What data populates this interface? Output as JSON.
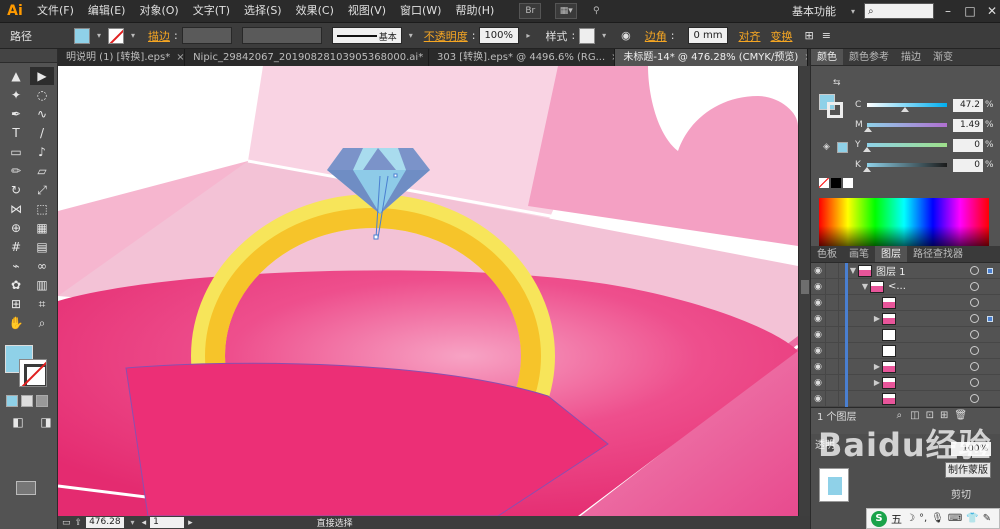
{
  "app": {
    "logo": "Ai",
    "workspace": "基本功能",
    "search_placeholder": ""
  },
  "menu": [
    "文件(F)",
    "编辑(E)",
    "对象(O)",
    "文字(T)",
    "选择(S)",
    "效果(C)",
    "视图(V)",
    "窗口(W)",
    "帮助(H)"
  ],
  "menubar_icons": [
    "bridge-icon",
    "arrange-documents-icon",
    "gpu-icon"
  ],
  "control": {
    "type_label": "路径",
    "stroke_label": "描边",
    "stroke_style": "基本",
    "opacity_label": "不透明度",
    "opacity_value": "100%",
    "style_label": "样式",
    "corner_label": "边角",
    "corner_value": "0 mm",
    "align_label": "对齐",
    "transform_label": "变换"
  },
  "tabs": [
    {
      "label": "明说明 (1) [转换].eps*",
      "active": false
    },
    {
      "label": "Nipic_29842067_20190828103905368000.ai*",
      "active": false
    },
    {
      "label": "303 [转换].eps* @ 4496.6% (RG...",
      "active": false
    },
    {
      "label": "未标题-14* @ 476.28% (CMYK/预览)",
      "active": true
    }
  ],
  "tools": [
    [
      "selection-tool-icon",
      "▲"
    ],
    [
      "direct-selection-tool-icon",
      "▶"
    ],
    [
      "magic-wand-tool-icon",
      "✦"
    ],
    [
      "lasso-tool-icon",
      "◌"
    ],
    [
      "pen-tool-icon",
      "✒"
    ],
    [
      "curvature-tool-icon",
      "∿"
    ],
    [
      "type-tool-icon",
      "T"
    ],
    [
      "line-tool-icon",
      "/"
    ],
    [
      "rectangle-tool-icon",
      "▭"
    ],
    [
      "paintbrush-tool-icon",
      "♪"
    ],
    [
      "pencil-tool-icon",
      "✏"
    ],
    [
      "eraser-tool-icon",
      "▱"
    ],
    [
      "rotate-tool-icon",
      "↻"
    ],
    [
      "scale-tool-icon",
      "⤢"
    ],
    [
      "width-tool-icon",
      "⋈"
    ],
    [
      "free-transform-tool-icon",
      "⬚"
    ],
    [
      "shape-builder-tool-icon",
      "⊕"
    ],
    [
      "perspective-grid-tool-icon",
      "▦"
    ],
    [
      "mesh-tool-icon",
      "#"
    ],
    [
      "gradient-tool-icon",
      "▤"
    ],
    [
      "eyedropper-tool-icon",
      "⌁"
    ],
    [
      "blend-tool-icon",
      "∞"
    ],
    [
      "symbol-sprayer-tool-icon",
      "✿"
    ],
    [
      "column-graph-tool-icon",
      "▥"
    ],
    [
      "artboard-tool-icon",
      "⊞"
    ],
    [
      "slice-tool-icon",
      "⌗"
    ],
    [
      "hand-tool-icon",
      "✋"
    ],
    [
      "zoom-tool-icon",
      "⌕"
    ]
  ],
  "color_panel": {
    "tabs": [
      "颜色",
      "颜色参考",
      "描边",
      "渐变"
    ],
    "channels": [
      {
        "letter": "C",
        "value": "47.2",
        "gradient": "linear-gradient(to right,#ffffff,#00aeef)",
        "level": 0.472
      },
      {
        "letter": "M",
        "value": "1.49",
        "gradient": "linear-gradient(to right,#8fd1e8,#b06fd0)",
        "level": 0.0149
      },
      {
        "letter": "Y",
        "value": "0",
        "gradient": "linear-gradient(to right,#8fd1e8,#9ee08a)",
        "level": 0
      },
      {
        "letter": "K",
        "value": "0",
        "gradient": "linear-gradient(to right,#8fd1e8,#1a1a1a)",
        "level": 0
      }
    ],
    "pct": "%"
  },
  "layers_panel": {
    "tabs": [
      "色板",
      "画笔",
      "图层",
      "路径查找器"
    ],
    "rows": [
      {
        "indent": 0,
        "tri": "▼",
        "name": "图层 1",
        "thumb": "pink",
        "sel": true
      },
      {
        "indent": 1,
        "tri": "▼",
        "name": "<...",
        "thumb": "pink",
        "sel": false
      },
      {
        "indent": 2,
        "tri": "",
        "name": "",
        "thumb": "pink",
        "sel": false
      },
      {
        "indent": 2,
        "tri": "▶",
        "name": "",
        "thumb": "pink",
        "sel": true
      },
      {
        "indent": 2,
        "tri": "",
        "name": "",
        "thumb": "white",
        "sel": false
      },
      {
        "indent": 2,
        "tri": "",
        "name": "",
        "thumb": "white",
        "sel": false
      },
      {
        "indent": 2,
        "tri": "▶",
        "name": "",
        "thumb": "pink",
        "sel": false
      },
      {
        "indent": 2,
        "tri": "▶",
        "name": "",
        "thumb": "pink",
        "sel": false
      },
      {
        "indent": 2,
        "tri": "",
        "name": "",
        "thumb": "pink",
        "sel": false
      }
    ],
    "footer": "1 个图层"
  },
  "lower_panel": {
    "tab": "透明",
    "value": "100%",
    "button": "制作蒙版",
    "label": "剪切"
  },
  "status": {
    "zoom": "476.28",
    "artboard": "1",
    "tool": "直接选择"
  },
  "watermark": "Baidu经验",
  "ime": {
    "logo": "S",
    "mode": "五"
  },
  "colors": {
    "pink_bg": "#f6a8c6",
    "hot_pink": "#ee2f77",
    "gold": "#f6c42a",
    "diamond": "#8ecbe8"
  }
}
